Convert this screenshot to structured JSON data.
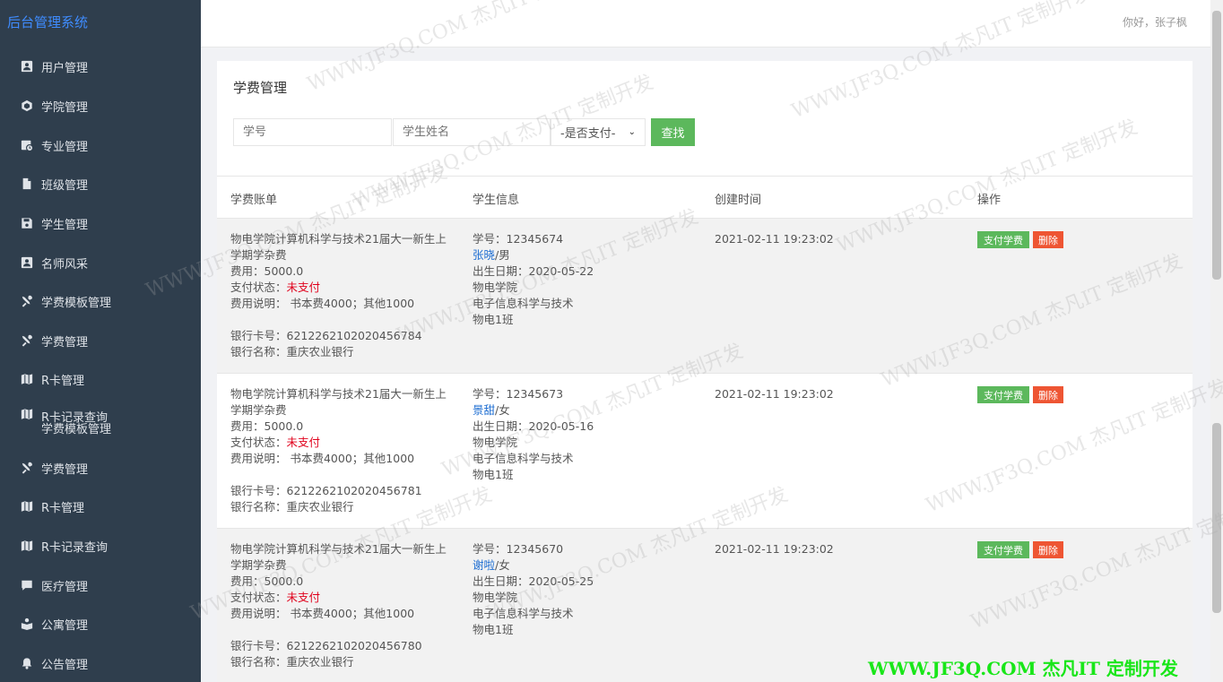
{
  "app": {
    "brand": "后台管理系统",
    "greeting": "你好，张子枫"
  },
  "sidebar": {
    "items": [
      {
        "label": "用户管理",
        "icon": "user-card-icon"
      },
      {
        "label": "学院管理",
        "icon": "cube-icon"
      },
      {
        "label": "专业管理",
        "icon": "calendar-clock-icon"
      },
      {
        "label": "班级管理",
        "icon": "document-icon"
      },
      {
        "label": "学生管理",
        "icon": "save-icon"
      },
      {
        "label": "名师风采",
        "icon": "user-card-icon"
      },
      {
        "label": "学费模板管理",
        "icon": "tools-icon"
      },
      {
        "label": "学费管理",
        "icon": "tools-icon"
      },
      {
        "label": "R卡管理",
        "icon": "map-icon"
      },
      {
        "label": "R卡记录查询",
        "label2": "学费模板管理",
        "icon": "map-icon"
      },
      {
        "label": "学费管理",
        "icon": "tools-icon"
      },
      {
        "label": "R卡管理",
        "icon": "map-icon"
      },
      {
        "label": "R卡记录查询",
        "icon": "map-icon"
      },
      {
        "label": "医疗管理",
        "icon": "chat-icon"
      },
      {
        "label": "公寓管理",
        "icon": "book-user-icon"
      },
      {
        "label": "公告管理",
        "icon": "bell-icon"
      }
    ]
  },
  "main": {
    "title": "学费管理",
    "search": {
      "student_no_placeholder": "学号",
      "student_name_placeholder": "学生姓名",
      "paid_select": "-是否支付-",
      "find_label": "查找"
    },
    "table": {
      "headers": [
        "学费账单",
        "学生信息",
        "创建时间",
        "操作"
      ],
      "rows": [
        {
          "bill_title": "物电学院计算机科学与技术21届大一新生上学期学杂费",
          "bill_title_line1": "物电学院计算机科学与技术21届大一新生上",
          "bill_title_line2": "学期学杂费",
          "fee": "费用：5000.0",
          "pay_status_label": "支付状态：",
          "pay_status": "未支付",
          "fee_desc": "费用说明：  书本费4000；其他1000",
          "card_no": "银行卡号：6212262102020456784",
          "bank": "银行名称：重庆农业银行",
          "student_no": "学号：12345674",
          "student_name": "张晓",
          "student_gender": "/男",
          "birth": "出生日期：2020-05-22",
          "college": "物电学院",
          "major": "电子信息科学与技术",
          "class": "物电1班",
          "created": "2021-02-11 19:23:02",
          "pay_btn": "支付学费",
          "del_btn": "删除"
        },
        {
          "bill_title_line1": "物电学院计算机科学与技术21届大一新生上",
          "bill_title_line2": "学期学杂费",
          "fee": "费用：5000.0",
          "pay_status_label": "支付状态：",
          "pay_status": "未支付",
          "fee_desc": "费用说明：  书本费4000；其他1000",
          "card_no": "银行卡号：6212262102020456781",
          "bank": "银行名称：重庆农业银行",
          "student_no": "学号：12345673",
          "student_name": "景甜",
          "student_gender": "/女",
          "birth": "出生日期：2020-05-16",
          "college": "物电学院",
          "major": "电子信息科学与技术",
          "class": "物电1班",
          "created": "2021-02-11 19:23:02",
          "pay_btn": "支付学费",
          "del_btn": "删除"
        },
        {
          "bill_title_line1": "物电学院计算机科学与技术21届大一新生上",
          "bill_title_line2": "学期学杂费",
          "fee": "费用：5000.0",
          "pay_status_label": "支付状态：",
          "pay_status": "未支付",
          "fee_desc": "费用说明：  书本费4000；其他1000",
          "card_no": "银行卡号：6212262102020456780",
          "bank": "银行名称：重庆农业银行",
          "student_no": "学号：12345670",
          "student_name": "谢啦",
          "student_gender": "/女",
          "birth": "出生日期：2020-05-25",
          "college": "物电学院",
          "major": "电子信息科学与技术",
          "class": "物电1班",
          "created": "2021-02-11 19:23:02",
          "pay_btn": "支付学费",
          "del_btn": "删除"
        }
      ]
    }
  },
  "watermark": {
    "text": "WWW.JF3Q.COM 杰凡IT 定制开发",
    "footer": "WWW.JF3Q.COM 杰凡IT  定制开发",
    "footer_color": "#19e619"
  },
  "colors": {
    "sidebar_bg": "#2f3e4d",
    "brand": "#3f8cff",
    "green": "#5cb85c",
    "red_btn": "#ee5533",
    "unpaid": "#e0001b",
    "link": "#1e6ed2"
  }
}
